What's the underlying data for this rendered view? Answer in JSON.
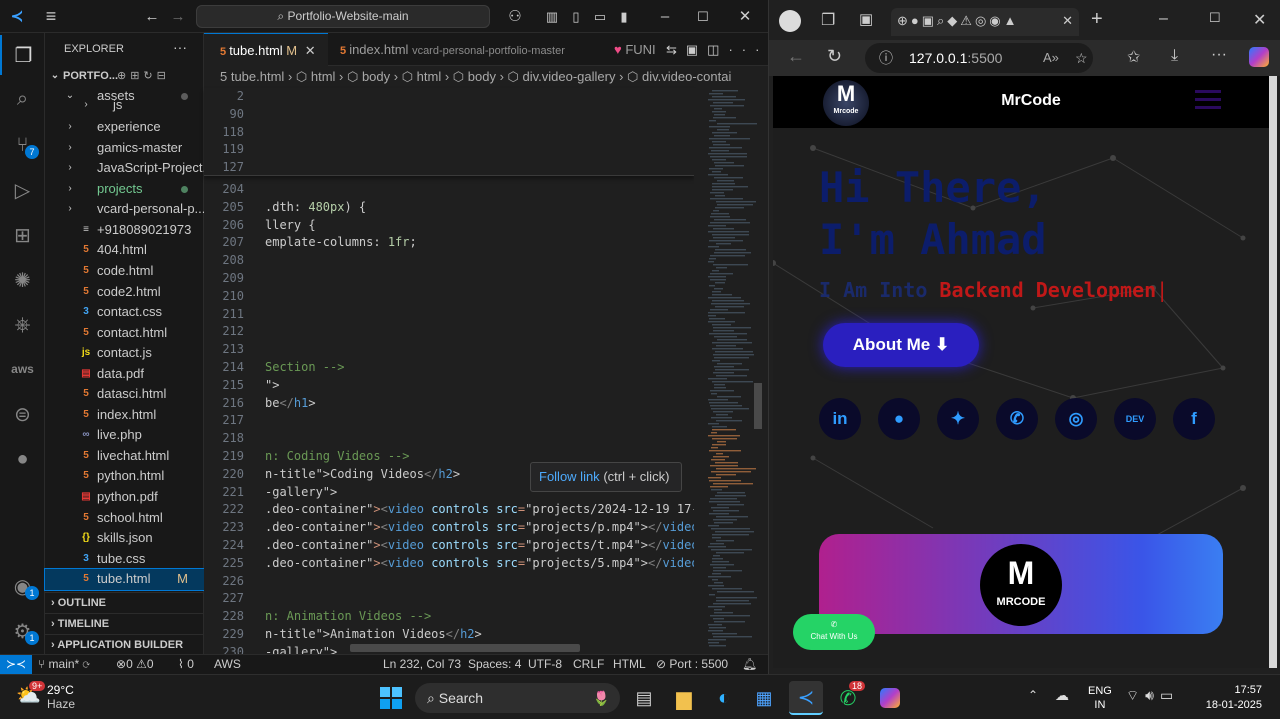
{
  "vscode": {
    "search_text": "Portfolio-Website-main",
    "explorer": {
      "title": "EXPLORER",
      "more": "···",
      "root": "PORTFO...",
      "items": [
        {
          "label": "assets",
          "type": "folder-open",
          "depth": 1
        },
        {
          "label": "js",
          "type": "folder",
          "depth": 2
        },
        {
          "label": "experience",
          "type": "folder",
          "depth": 1
        },
        {
          "label": "gamics-master",
          "type": "folder",
          "depth": 1
        },
        {
          "label": "JavaScript-Project...",
          "type": "folder",
          "depth": 1
        },
        {
          "label": "projects",
          "type": "folder",
          "depth": 1
        },
        {
          "label": "vcard-personal-p...",
          "type": "folder",
          "depth": 1
        },
        {
          "label": "+918089021973",
          "type": "file",
          "depth": 1
        },
        {
          "label": "404.html",
          "type": "html",
          "depth": 1
        },
        {
          "label": "code.html",
          "type": "html",
          "depth": 1
        },
        {
          "label": "code2.html",
          "type": "html",
          "depth": 1
        },
        {
          "label": "contact.css",
          "type": "css",
          "depth": 1
        },
        {
          "label": "contact.html",
          "type": "html",
          "depth": 1
        },
        {
          "label": "contact.js",
          "type": "js",
          "depth": 1
        },
        {
          "label": "data.pdf",
          "type": "pdf",
          "depth": 1
        },
        {
          "label": "datasci.html",
          "type": "html",
          "depth": 1
        },
        {
          "label": "index.html",
          "type": "html",
          "depth": 1
        },
        {
          "label": "live.php",
          "type": "php",
          "depth": 1
        },
        {
          "label": "livechat.html",
          "type": "html",
          "depth": 1
        },
        {
          "label": "python.html",
          "type": "html",
          "depth": 1
        },
        {
          "label": "python.pdf",
          "type": "pdf",
          "depth": 1
        },
        {
          "label": "school.html",
          "type": "html",
          "depth": 1
        },
        {
          "label": "skills.json",
          "type": "json",
          "depth": 1
        },
        {
          "label": "tube.css",
          "type": "css",
          "depth": 1
        },
        {
          "label": "tube.html",
          "type": "html",
          "depth": 1,
          "badge": "M"
        }
      ],
      "sections": [
        "OUTLINE",
        "TIMELINE",
        "APPLICATION BUILDER"
      ]
    },
    "tabs": [
      {
        "label": "tube.html",
        "flag": "M"
      },
      {
        "label": "index.html",
        "hint": "vcard-personal-portfolio-master"
      },
      {
        "label": "FUNI"
      }
    ],
    "breadcrumb": [
      "tube.html",
      "html",
      "body",
      "html",
      "body",
      "div.video-gallery",
      "div.video-contai"
    ],
    "sticky_lines": [
      "2",
      "90",
      "118",
      "119",
      "127"
    ],
    "code_lines": [
      {
        "n": "204",
        "t": ""
      },
      {
        "n": "205",
        "t": ".dth: 480px) {"
      },
      {
        "n": "206",
        "t": "llery {"
      },
      {
        "n": "207",
        "t": "emplate-columns: 1fr;"
      },
      {
        "n": "208",
        "t": ""
      },
      {
        "n": "209",
        "t": ""
      },
      {
        "n": "210",
        "t": ""
      },
      {
        "n": "211",
        "t": ""
      },
      {
        "n": "212",
        "t": ""
      },
      {
        "n": "213",
        "t": ""
      },
      {
        "n": "214",
        "t": "Section -->"
      },
      {
        "n": "215",
        "t": "\">"
      },
      {
        "n": "216",
        "t": "be</h1>"
      },
      {
        "n": "217",
        "t": ""
      },
      {
        "n": "218",
        "t": ""
      },
      {
        "n": "219",
        "t": "n: Coding Videos -->"
      },
      {
        "n": "220",
        "t": "n-title\">Coding Videos</h2>"
      },
      {
        "n": "221",
        "t": "-gallery\">"
      },
      {
        "n": "222",
        "t": ".deo-container\"><video controls src=\"projects/2024-12-19 17-"
      },
      {
        "n": "223",
        "t": ".deo-container\"><video controls src=\"projects/p.mp4\"></video"
      },
      {
        "n": "224",
        "t": ".deo-container\"><video controls src=\"projects/t.mp4\"></video"
      },
      {
        "n": "225",
        "t": ".deo-container\"><video controls src=\"projects/5.mp4\"></video"
      },
      {
        "n": "226",
        "t": ""
      },
      {
        "n": "227",
        "t": ""
      },
      {
        "n": "228",
        "t": "n: Animation Videos -->"
      },
      {
        "n": "229",
        "t": "n-title\">Animation Videos</h2>"
      },
      {
        "n": "230",
        "t": "-gallery\">"
      }
    ],
    "tooltip": {
      "link": "Follow link",
      "keys": "(ctrl + click)"
    },
    "status": {
      "branch": "main*",
      "errors": "0",
      "warnings": "0",
      "ports": "0",
      "aws": "AWS",
      "position": "Ln 232, Col 73",
      "spaces": "Spaces: 4",
      "encoding": "UTF-8",
      "eol": "CRLF",
      "language": "HTML",
      "port": "Port : 5500"
    },
    "activity_badges": {
      "source_control": "7",
      "accounts": "1",
      "settings": "1"
    }
  },
  "browser": {
    "url_host": "127.0.0.1",
    "url_port": ":5500",
    "site": {
      "brand": "MrCode",
      "logo_caption": "Mrcode",
      "hero_line1": "Hi There,",
      "hero_line2": "I'm Ahmad",
      "typing_prefix": "I Am Into",
      "typing_text": "Backend Developmen",
      "about_button": "About Me",
      "socials": [
        "linkedin-icon",
        "github-icon",
        "twitter-icon",
        "whatsapp-icon",
        "instagram-icon",
        "dev-icon",
        "facebook-icon"
      ],
      "dev_label": "DEV",
      "card_logo_text": "MRCODE",
      "chat_button": "Chat With Us"
    }
  },
  "taskbar": {
    "temp": "29°C",
    "weather": "Haze",
    "weather_badge": "9+",
    "search": "Search",
    "whatsapp_badge": "18",
    "lang1": "ENG",
    "lang2": "IN",
    "time": "17:57",
    "date": "18-01-2025"
  },
  "colors": {
    "vscode_blue": "#0078d4",
    "hero_text": "#0c1d6b",
    "typing_red": "#c01818",
    "button_blue": "#2a1fbf"
  }
}
